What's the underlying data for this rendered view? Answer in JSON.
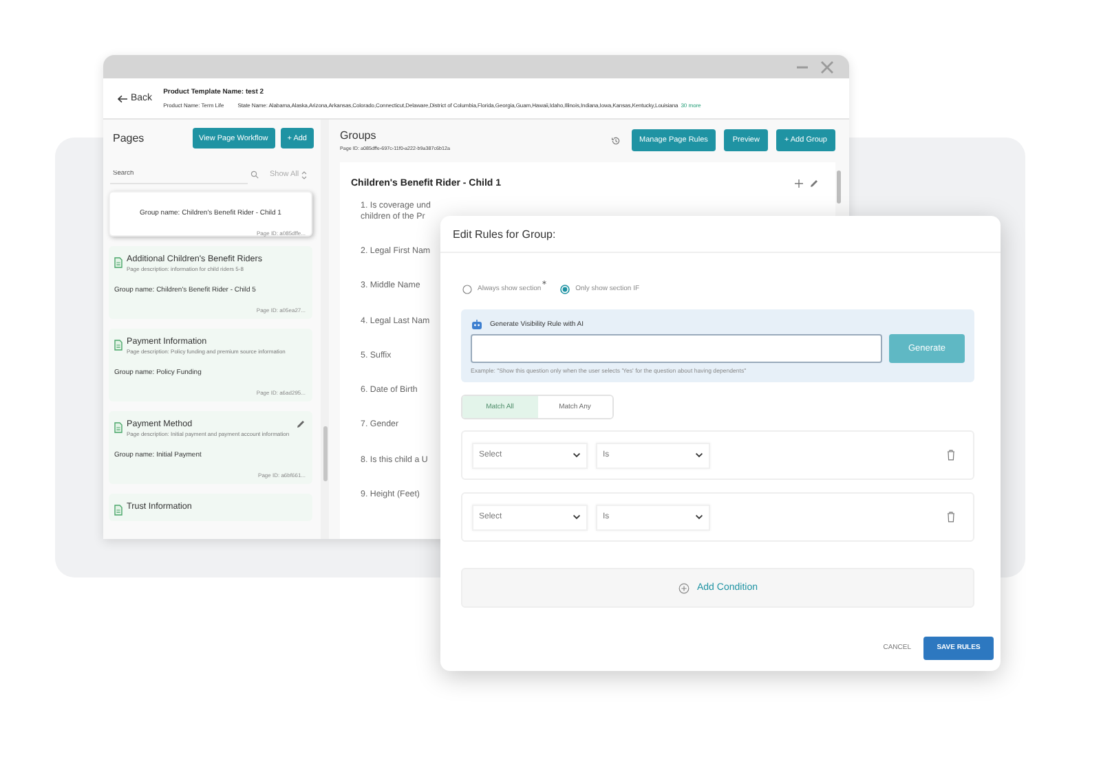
{
  "header": {
    "back": "Back",
    "template_name": "Product Template Name: test 2",
    "product_name": "Product Name: Term Life",
    "state_name": "State Name: Alabama,Alaska,Arizona,Arkansas,Colorado,Connecticut,Delaware,District of Columbia,Florida,Georgia,Guam,Hawaii,Idaho,Illinois,Indiana,Iowa,Kansas,Kentucky,Louisiana",
    "more": "30 more"
  },
  "pages": {
    "title": "Pages",
    "buttons": [
      "View Page Workflow",
      "+ Add"
    ],
    "search": {
      "placeholder": "Search"
    },
    "filter": "Show All",
    "cards": [
      {
        "group": "Group name: Children's Benefit Rider - Child 1",
        "page_id": "Page ID: a085dffe...",
        "selected": true
      },
      {
        "title": "Additional Children's Benefit Riders",
        "description": "Page description: information for child riders 5-8",
        "group": "Group name: Children's Benefit Rider - Child 5",
        "page_id": "Page ID: a05ea27...",
        "selected": false
      },
      {
        "title": "Payment Information",
        "description": "Page description: Policy funding and premium source information",
        "group": "Group name: Policy Funding",
        "page_id": "Page ID: a6ad295...",
        "selected": false
      },
      {
        "title": "Payment Method",
        "description": "Page description: Initial payment and payment account information",
        "group": "Group name: Initial Payment",
        "page_id": "Page ID: a6bf661...",
        "selected": false,
        "editable": true
      },
      {
        "title": "Trust Information",
        "selected": false
      }
    ]
  },
  "groups": {
    "title": "Groups",
    "page_id": "Page ID: a085dffe-697c-11f0-a222-b9a387c6b12a",
    "buttons": [
      "Manage Page Rules",
      "Preview",
      "+ Add Group"
    ],
    "group": {
      "title": "Children's Benefit Rider - Child 1",
      "questions": [
        {
          "lines": [
            "1. Is coverage und",
            "children of the Pr"
          ]
        },
        {
          "lines": [
            "2. Legal First Nam"
          ]
        },
        {
          "lines": [
            "3. Middle Name"
          ]
        },
        {
          "lines": [
            "4. Legal Last Nam"
          ]
        },
        {
          "lines": [
            "5. Suffix"
          ]
        },
        {
          "lines": [
            "6. Date of Birth"
          ]
        },
        {
          "lines": [
            "7. Gender"
          ]
        },
        {
          "lines": [
            "8. Is this child a U"
          ]
        },
        {
          "lines": [
            "9. Height (Feet)"
          ]
        }
      ]
    }
  },
  "modal": {
    "title": "Edit Rules for Group:",
    "options": [
      {
        "label": "Always show section",
        "selected": false,
        "required": true
      },
      {
        "label": "Only show section IF",
        "selected": true,
        "required": false
      }
    ],
    "ai": {
      "label": "Generate Visibility Rule with AI",
      "button": "Generate",
      "example": "Example: \"Show this question only when the user selects 'Yes' for the question about having dependents\""
    },
    "match": [
      {
        "label": "Match All",
        "selected": true
      },
      {
        "label": "Match Any",
        "selected": false
      }
    ],
    "conditions": [
      {
        "field": "Select",
        "operator": "Is"
      },
      {
        "field": "Select",
        "operator": "Is"
      }
    ],
    "add": "Add Condition",
    "cancel": "CANCEL",
    "save": "SAVE RULES"
  }
}
